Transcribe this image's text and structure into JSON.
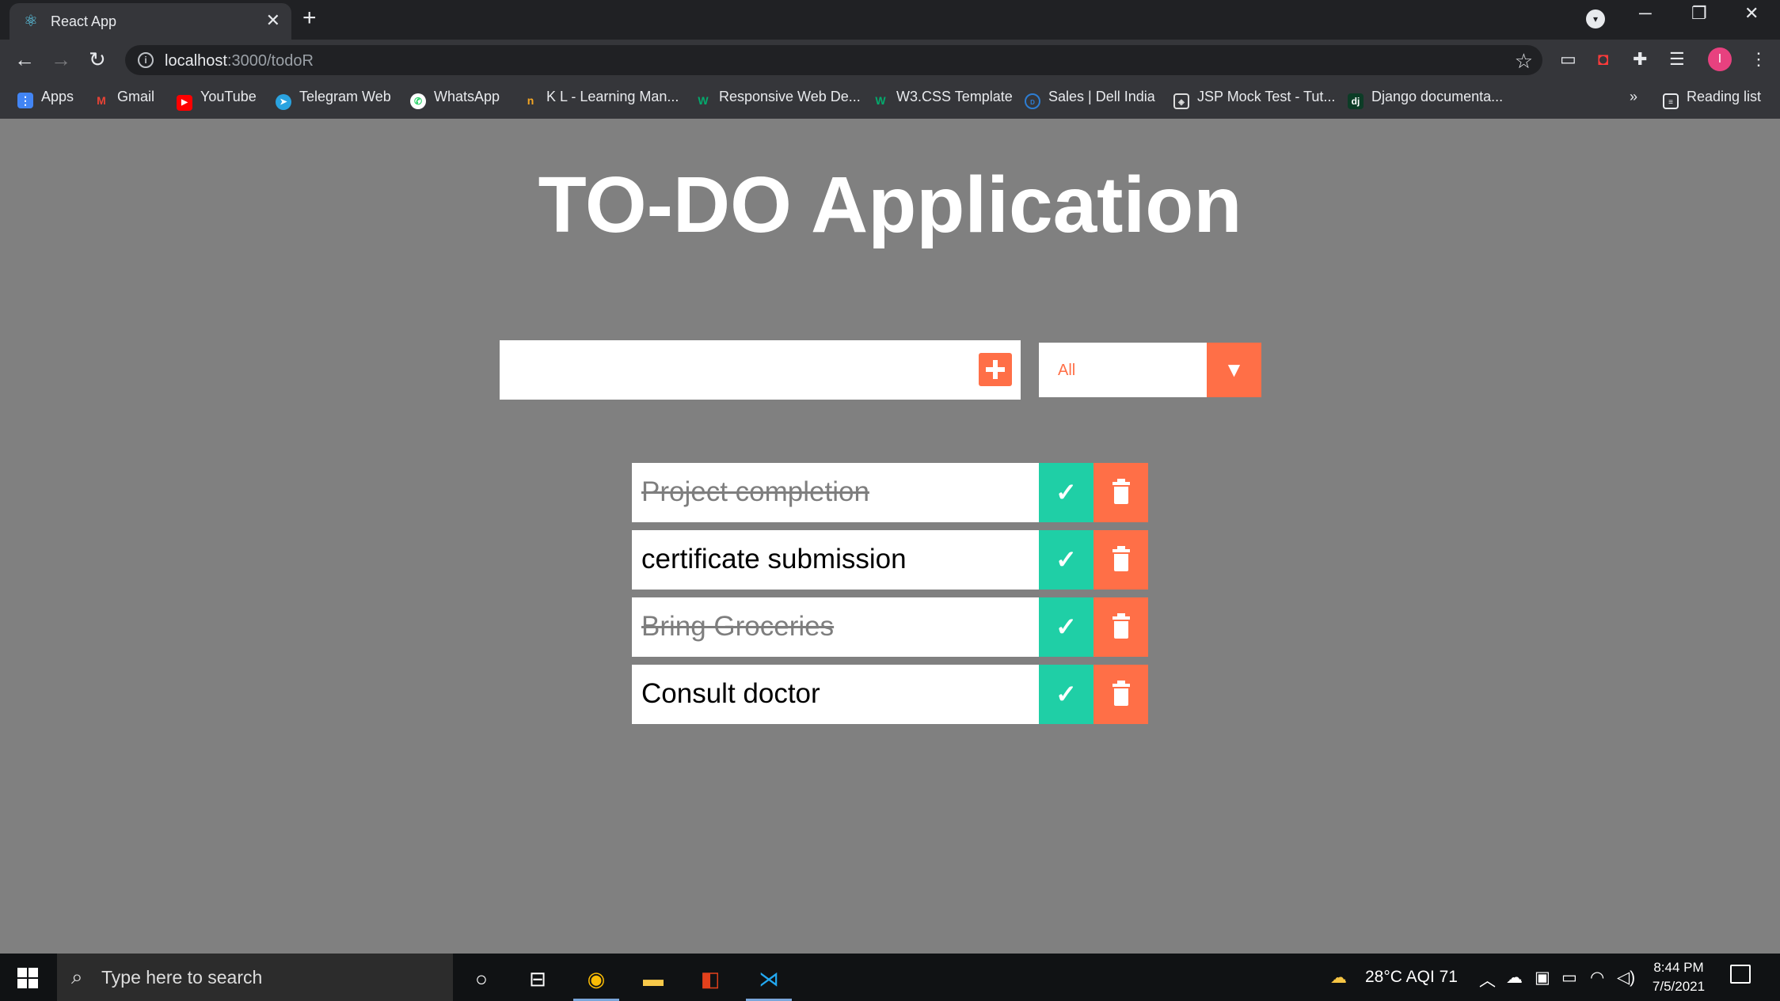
{
  "browser": {
    "tab_title": "React App",
    "url_host": "localhost",
    "url_rest": ":3000/todoR",
    "profile_initial": "I",
    "bookmarks": [
      {
        "label": "Apps",
        "icon": "apps-grid-icon"
      },
      {
        "label": "Gmail",
        "icon": "gmail-icon"
      },
      {
        "label": "YouTube",
        "icon": "youtube-icon"
      },
      {
        "label": "Telegram Web",
        "icon": "telegram-icon"
      },
      {
        "label": "WhatsApp",
        "icon": "whatsapp-icon"
      },
      {
        "label": "K L - Learning Man...",
        "icon": "kl-icon"
      },
      {
        "label": "Responsive Web De...",
        "icon": "w3schools-icon"
      },
      {
        "label": "W3.CSS Template",
        "icon": "w3schools-icon"
      },
      {
        "label": "Sales | Dell India",
        "icon": "dell-icon"
      },
      {
        "label": "JSP Mock Test - Tut...",
        "icon": "tutorialspoint-icon"
      },
      {
        "label": "Django documenta...",
        "icon": "django-icon"
      }
    ],
    "reading_list": "Reading list",
    "more_bookmarks": "»"
  },
  "app": {
    "title": "TO-DO Application",
    "input_value": "",
    "filter_selected": "All",
    "todos": [
      {
        "text": "Project completion",
        "completed": true
      },
      {
        "text": "certificate submission",
        "completed": false
      },
      {
        "text": "Bring Groceries",
        "completed": true
      },
      {
        "text": "Consult doctor",
        "completed": false
      }
    ]
  },
  "taskbar": {
    "search_placeholder": "Type here to search",
    "weather": "28°C  AQI 71",
    "time": "8:44 PM",
    "date": "7/5/2021"
  },
  "colors": {
    "accent": "#ff6f47",
    "complete": "#1fcfa6",
    "background": "#808080"
  }
}
